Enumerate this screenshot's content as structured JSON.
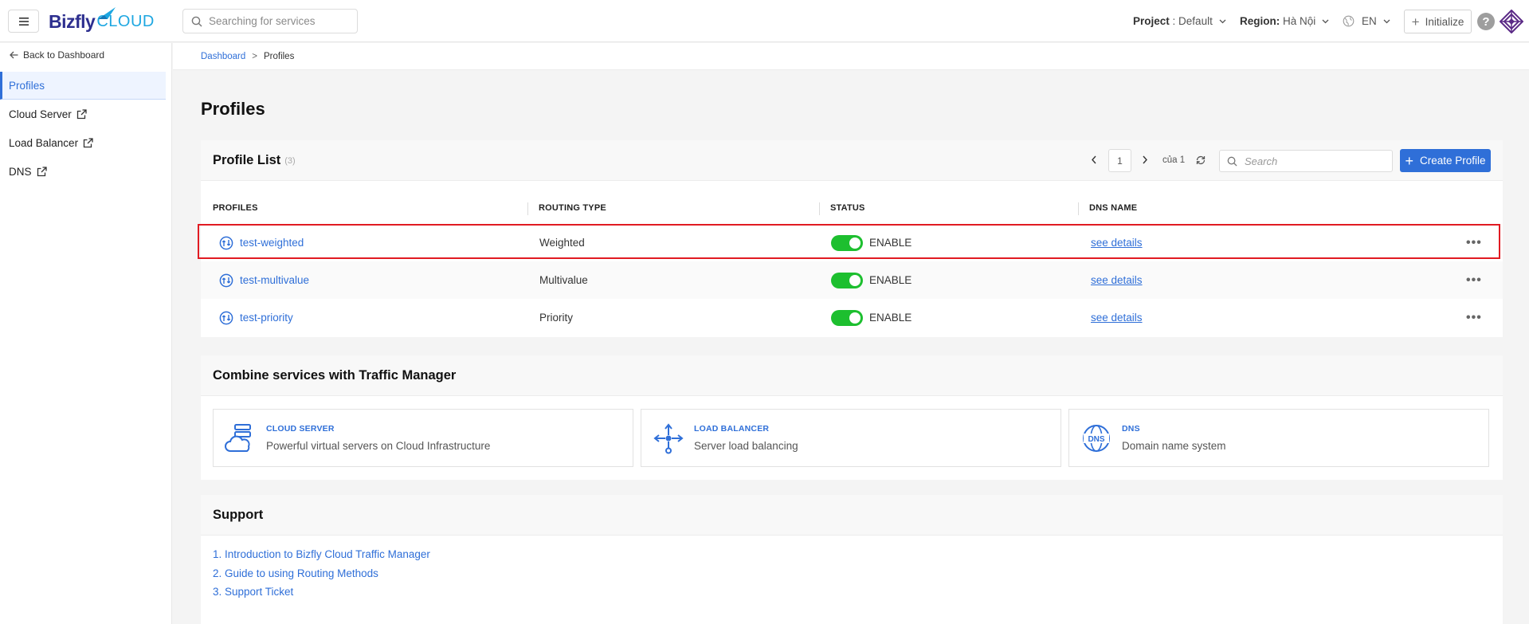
{
  "topbar": {
    "brand_part1": "Bizfly",
    "brand_part2": "CLOUD",
    "search_placeholder": "Searching for services",
    "project_label": "Project",
    "project_value": ": Default",
    "region_label": "Region:",
    "region_value": "Hà Nội",
    "language": "EN",
    "initialize_label": "Initialize",
    "help_label": "?"
  },
  "sidebar": {
    "back_label": "Back to Dashboard",
    "items": [
      {
        "label": "Profiles",
        "active": true
      },
      {
        "label": "Cloud Server",
        "external": true
      },
      {
        "label": "Load Balancer",
        "external": true
      },
      {
        "label": "DNS",
        "external": true
      }
    ]
  },
  "breadcrumb": {
    "items": [
      "Dashboard",
      "Profiles"
    ],
    "separator": ">"
  },
  "page": {
    "title": "Profiles"
  },
  "profile_list": {
    "title": "Profile List",
    "count": "(3)",
    "page_current": "1",
    "page_of": "của 1",
    "search_placeholder": "Search",
    "create_label": "Create Profile",
    "columns": [
      "PROFILES",
      "ROUTING TYPE",
      "STATUS",
      "DNS NAME"
    ],
    "rows": [
      {
        "name": "test-weighted",
        "routing": "Weighted",
        "status": "ENABLE",
        "dns": "see details",
        "enabled": true
      },
      {
        "name": "test-multivalue",
        "routing": "Multivalue",
        "status": "ENABLE",
        "dns": "see details",
        "enabled": true
      },
      {
        "name": "test-priority",
        "routing": "Priority",
        "status": "ENABLE",
        "dns": "see details",
        "enabled": true
      }
    ],
    "more_label": "•••"
  },
  "combine": {
    "title": "Combine services with Traffic Manager",
    "services": [
      {
        "name": "CLOUD SERVER",
        "desc": "Powerful virtual servers on Cloud Infrastructure",
        "icon": "cloud-server-icon"
      },
      {
        "name": "LOAD BALANCER",
        "desc": "Server load balancing",
        "icon": "load-balancer-icon"
      },
      {
        "name": "DNS",
        "desc": "Domain name system",
        "icon": "dns-globe-icon"
      }
    ]
  },
  "support": {
    "title": "Support",
    "links": [
      "1. Introduction to Bizfly Cloud Traffic Manager",
      "2. Guide to using Routing Methods",
      "3. Support Ticket"
    ]
  },
  "colors": {
    "accent": "#2f6fd8",
    "toggle_on": "#1dbf2f",
    "highlight": "#e11b22"
  }
}
